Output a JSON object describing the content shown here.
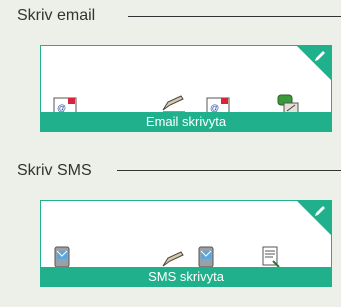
{
  "sections": [
    {
      "title": "Skriv email",
      "card_label": "Email skrivyta",
      "icons": [
        "email-icon",
        "pen-writing-icon",
        "email-icon",
        "phone-contact-icon"
      ]
    },
    {
      "title": "Skriv SMS",
      "card_label": "SMS skrivyta",
      "icons": [
        "mobile-message-icon",
        "pen-writing-icon",
        "mobile-message-icon",
        "document-icon"
      ]
    }
  ],
  "colors": {
    "accent": "#20b08c",
    "background": "#ecf0e8"
  }
}
